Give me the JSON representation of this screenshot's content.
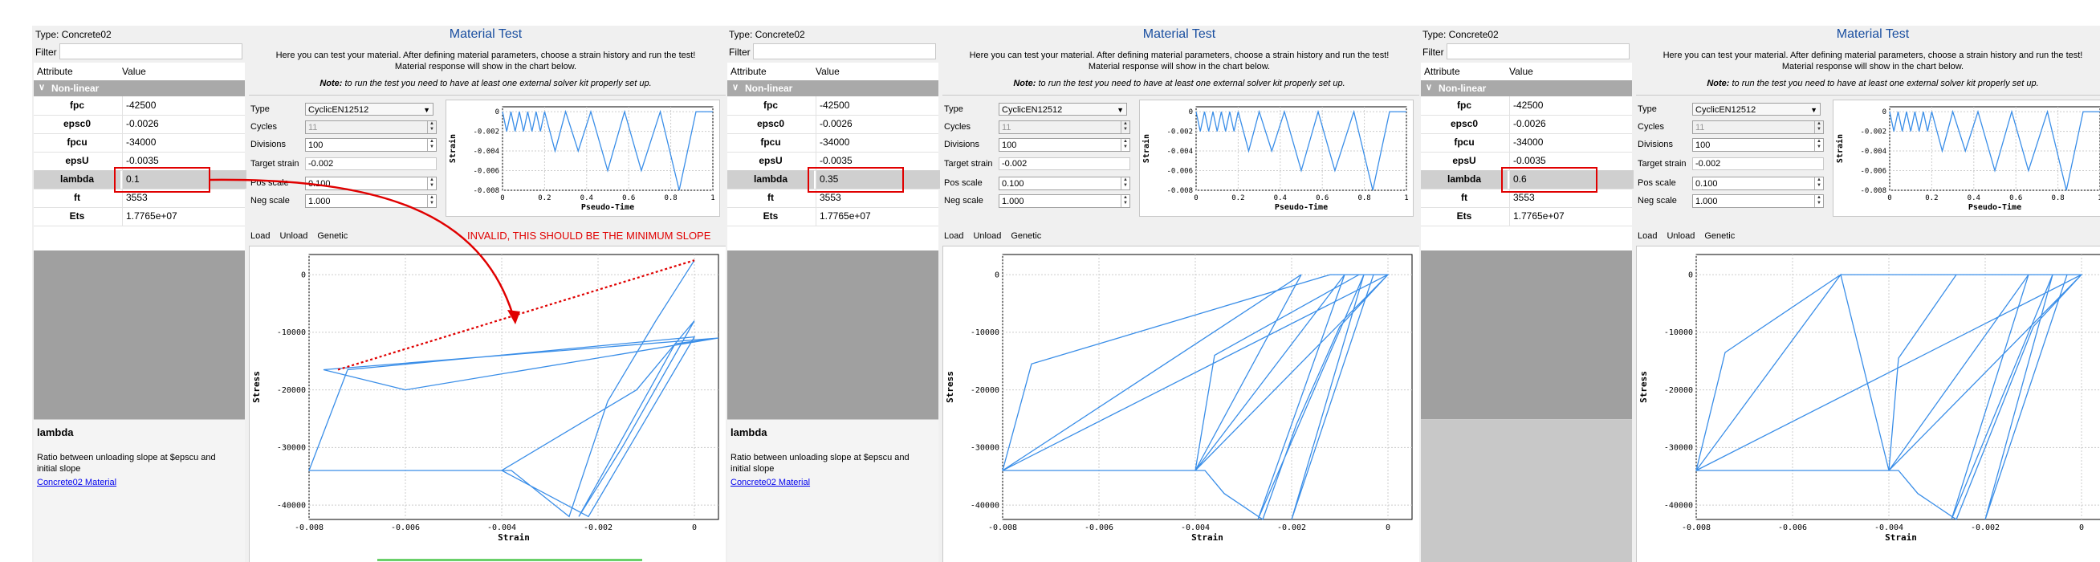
{
  "colors": {
    "accent": "#1a4fa0",
    "curve": "#3a8ee8",
    "annotation": "#e00000",
    "category": "#a9a9a9"
  },
  "panels": [
    {
      "type_line": "Type:  Concrete02",
      "filter_label": "Filter",
      "grid": {
        "col_attr": "Attribute",
        "col_value": "Value",
        "category": "Non-linear",
        "rows": [
          {
            "name": "fpc",
            "value": "-42500"
          },
          {
            "name": "epsc0",
            "value": "-0.0026"
          },
          {
            "name": "fpcu",
            "value": "-34000"
          },
          {
            "name": "epsU",
            "value": "-0.0035"
          },
          {
            "name": "lambda",
            "value": "0.1"
          },
          {
            "name": "ft",
            "value": "3553"
          },
          {
            "name": "Ets",
            "value": "1.7765e+07"
          }
        ]
      },
      "help": {
        "title": "lambda",
        "text": "Ratio between unloading slope at $epscu and initial slope",
        "link": "Concrete02 Material"
      },
      "test": {
        "title": "Material Test",
        "desc1": "Here you can test your material. After defining material parameters, choose a strain history and run the test!",
        "desc2": "Material response will show in the chart below.",
        "note_bold": "Note:",
        "note": " to run the test you need to have at least one external solver kit properly set up.",
        "labels": {
          "type": "Type",
          "cycles": "Cycles",
          "divisions": "Divisions",
          "target": "Target strain",
          "pos": "Pos scale",
          "neg": "Neg scale"
        },
        "values": {
          "type": "CyclicEN12512",
          "cycles": "11",
          "divisions": "100",
          "target": "-0.002",
          "pos": "0.100",
          "neg": "1.000"
        },
        "tabs": [
          "Load",
          "Unload",
          "Genetic"
        ]
      },
      "annotation": "INVALID, THIS SHOULD BE THE MINIMUM SLOPE"
    },
    {
      "type_line": "Type:  Concrete02",
      "filter_label": "Filter",
      "grid": {
        "col_attr": "Attribute",
        "col_value": "Value",
        "category": "Non-linear",
        "rows": [
          {
            "name": "fpc",
            "value": "-42500"
          },
          {
            "name": "epsc0",
            "value": "-0.0026"
          },
          {
            "name": "fpcu",
            "value": "-34000"
          },
          {
            "name": "epsU",
            "value": "-0.0035"
          },
          {
            "name": "lambda",
            "value": "0.35"
          },
          {
            "name": "ft",
            "value": "3553"
          },
          {
            "name": "Ets",
            "value": "1.7765e+07"
          }
        ]
      },
      "help": {
        "title": "lambda",
        "text": "Ratio between unloading slope at $epscu and initial slope",
        "link": "Concrete02 Material"
      },
      "test": {
        "title": "Material Test",
        "desc1": "Here you can test your material. After defining material parameters, choose a strain history and run the test!",
        "desc2": "Material response will show in the chart below.",
        "note_bold": "Note:",
        "note": " to run the test you need to have at least one external solver kit properly set up.",
        "labels": {
          "type": "Type",
          "cycles": "Cycles",
          "divisions": "Divisions",
          "target": "Target strain",
          "pos": "Pos scale",
          "neg": "Neg scale"
        },
        "values": {
          "type": "CyclicEN12512",
          "cycles": "11",
          "divisions": "100",
          "target": "-0.002",
          "pos": "0.100",
          "neg": "1.000"
        },
        "tabs": [
          "Load",
          "Unload",
          "Genetic"
        ]
      }
    },
    {
      "type_line": "Type:  Concrete02",
      "filter_label": "Filter",
      "grid": {
        "col_attr": "Attribute",
        "col_value": "Value",
        "category": "Non-linear",
        "rows": [
          {
            "name": "fpc",
            "value": "-42500"
          },
          {
            "name": "epsc0",
            "value": "-0.0026"
          },
          {
            "name": "fpcu",
            "value": "-34000"
          },
          {
            "name": "epsU",
            "value": "-0.0035"
          },
          {
            "name": "lambda",
            "value": "0.6"
          },
          {
            "name": "ft",
            "value": "3553"
          },
          {
            "name": "Ets",
            "value": "1.7765e+07"
          }
        ]
      },
      "test": {
        "title": "Material Test",
        "desc1": "Here you can test your material. After defining material parameters, choose a strain history and run the test!",
        "desc2": "Material response will show in the chart below.",
        "note_bold": "Note:",
        "note": " to run the test you need to have at least one external solver kit properly set up.",
        "labels": {
          "type": "Type",
          "cycles": "Cycles",
          "divisions": "Divisions",
          "target": "Target strain",
          "pos": "Pos scale",
          "neg": "Neg scale"
        },
        "values": {
          "type": "CyclicEN12512",
          "cycles": "11",
          "divisions": "100",
          "target": "-0.002",
          "pos": "0.100",
          "neg": "1.000"
        },
        "tabs": [
          "Load",
          "Unload",
          "Genetic"
        ]
      }
    }
  ],
  "chart_data": [
    {
      "type": "line",
      "chart": "strain-history",
      "xlabel": "Pseudo-Time",
      "ylabel": "Strain",
      "xlim": [
        0,
        1
      ],
      "ylim": [
        -0.008,
        0.0005
      ],
      "xticks": [
        "0",
        "0.2",
        "0.4",
        "0.6",
        "0.8",
        "1"
      ],
      "yticks": [
        "0",
        "-0.002",
        "-0.004",
        "-0.006",
        "-0.008"
      ],
      "x": [
        0,
        0.02,
        0.04,
        0.06,
        0.08,
        0.1,
        0.12,
        0.14,
        0.16,
        0.18,
        0.2,
        0.25,
        0.3,
        0.36,
        0.42,
        0.5,
        0.58,
        0.66,
        0.75,
        0.84,
        0.92,
        1.0
      ],
      "y": [
        0,
        -0.002,
        0,
        -0.002,
        0,
        -0.002,
        0,
        -0.002,
        0,
        -0.002,
        0,
        -0.004,
        0,
        -0.004,
        0,
        -0.006,
        0,
        -0.006,
        0,
        -0.008,
        0,
        0
      ]
    },
    {
      "type": "line",
      "chart": "stress-strain",
      "lambda": "0.1",
      "xlabel": "Strain",
      "ylabel": "Stress",
      "xlim": [
        -0.008,
        0.0005
      ],
      "ylim": [
        -42500,
        3500
      ],
      "xticks": [
        "-0.008",
        "-0.006",
        "-0.004",
        "-0.002",
        "0"
      ],
      "yticks": [
        "0",
        "-10000",
        "-20000",
        "-30000",
        "-40000"
      ],
      "x": [
        0,
        -0.0008,
        -0.0018,
        -0.0026,
        -0.0032,
        -0.0038,
        -0.0042,
        -0.008,
        -0.0072,
        0,
        -0.0022,
        -0.004,
        -0.0012,
        0,
        -0.0015,
        -0.0024,
        -0.0004,
        0.0005,
        -0.006,
        -0.0077,
        0.0005
      ],
      "y": [
        2500,
        -8000,
        -22000,
        -42000,
        -38000,
        -34000,
        -34000,
        -34000,
        -16500,
        -10800,
        -42000,
        -34000,
        -20000,
        -8000,
        -30000,
        -42000,
        -12000,
        -11000,
        -20000,
        -16500,
        -11000
      ]
    },
    {
      "type": "line",
      "chart": "stress-strain",
      "lambda": "0.35",
      "xlabel": "Strain",
      "ylabel": "Stress",
      "xlim": [
        -0.008,
        0.0005
      ],
      "ylim": [
        -42500,
        3500
      ],
      "xticks": [
        "-0.008",
        "-0.006",
        "-0.004",
        "-0.002",
        "0"
      ],
      "yticks": [
        "0",
        "-10000",
        "-20000",
        "-30000",
        "-40000"
      ],
      "x": [
        0,
        -0.001,
        -0.0019,
        -0.0026,
        -0.0034,
        -0.0038,
        -0.008,
        -0.0074,
        -0.0012,
        0,
        -0.008,
        -0.0018,
        -0.004,
        -0.0036,
        -0.0006,
        0,
        -0.004,
        -0.0009,
        -0.0027,
        -0.0005,
        -0.002,
        -0.0003
      ],
      "y": [
        0,
        -9000,
        -26000,
        -42500,
        -38000,
        -34000,
        -34000,
        -15500,
        0,
        0,
        -34000,
        0,
        -34000,
        -14000,
        0,
        0,
        -34000,
        0,
        -42500,
        0,
        -42500,
        0
      ]
    },
    {
      "type": "line",
      "chart": "stress-strain",
      "lambda": "0.6",
      "xlabel": "Strain",
      "ylabel": "Stress",
      "xlim": [
        -0.008,
        0.0005
      ],
      "ylim": [
        -42500,
        3500
      ],
      "xticks": [
        "-0.008",
        "-0.006",
        "-0.004",
        "-0.002",
        "0"
      ],
      "yticks": [
        "0",
        "-10000",
        "-20000",
        "-30000",
        "-40000"
      ],
      "x": [
        0,
        -0.001,
        -0.002,
        -0.0026,
        -0.0034,
        -0.0038,
        -0.008,
        -0.0074,
        -0.005,
        0,
        -0.008,
        -0.005,
        -0.004,
        -0.0038,
        -0.0026,
        0,
        -0.004,
        -0.0011,
        -0.0027,
        -0.0006,
        -0.002,
        -0.0003
      ],
      "y": [
        0,
        -9000,
        -30000,
        -42500,
        -38000,
        -34000,
        -34000,
        -13500,
        0,
        0,
        -34000,
        0,
        -34000,
        -14500,
        0,
        0,
        -34000,
        0,
        -42500,
        0,
        -42500,
        0
      ]
    }
  ]
}
